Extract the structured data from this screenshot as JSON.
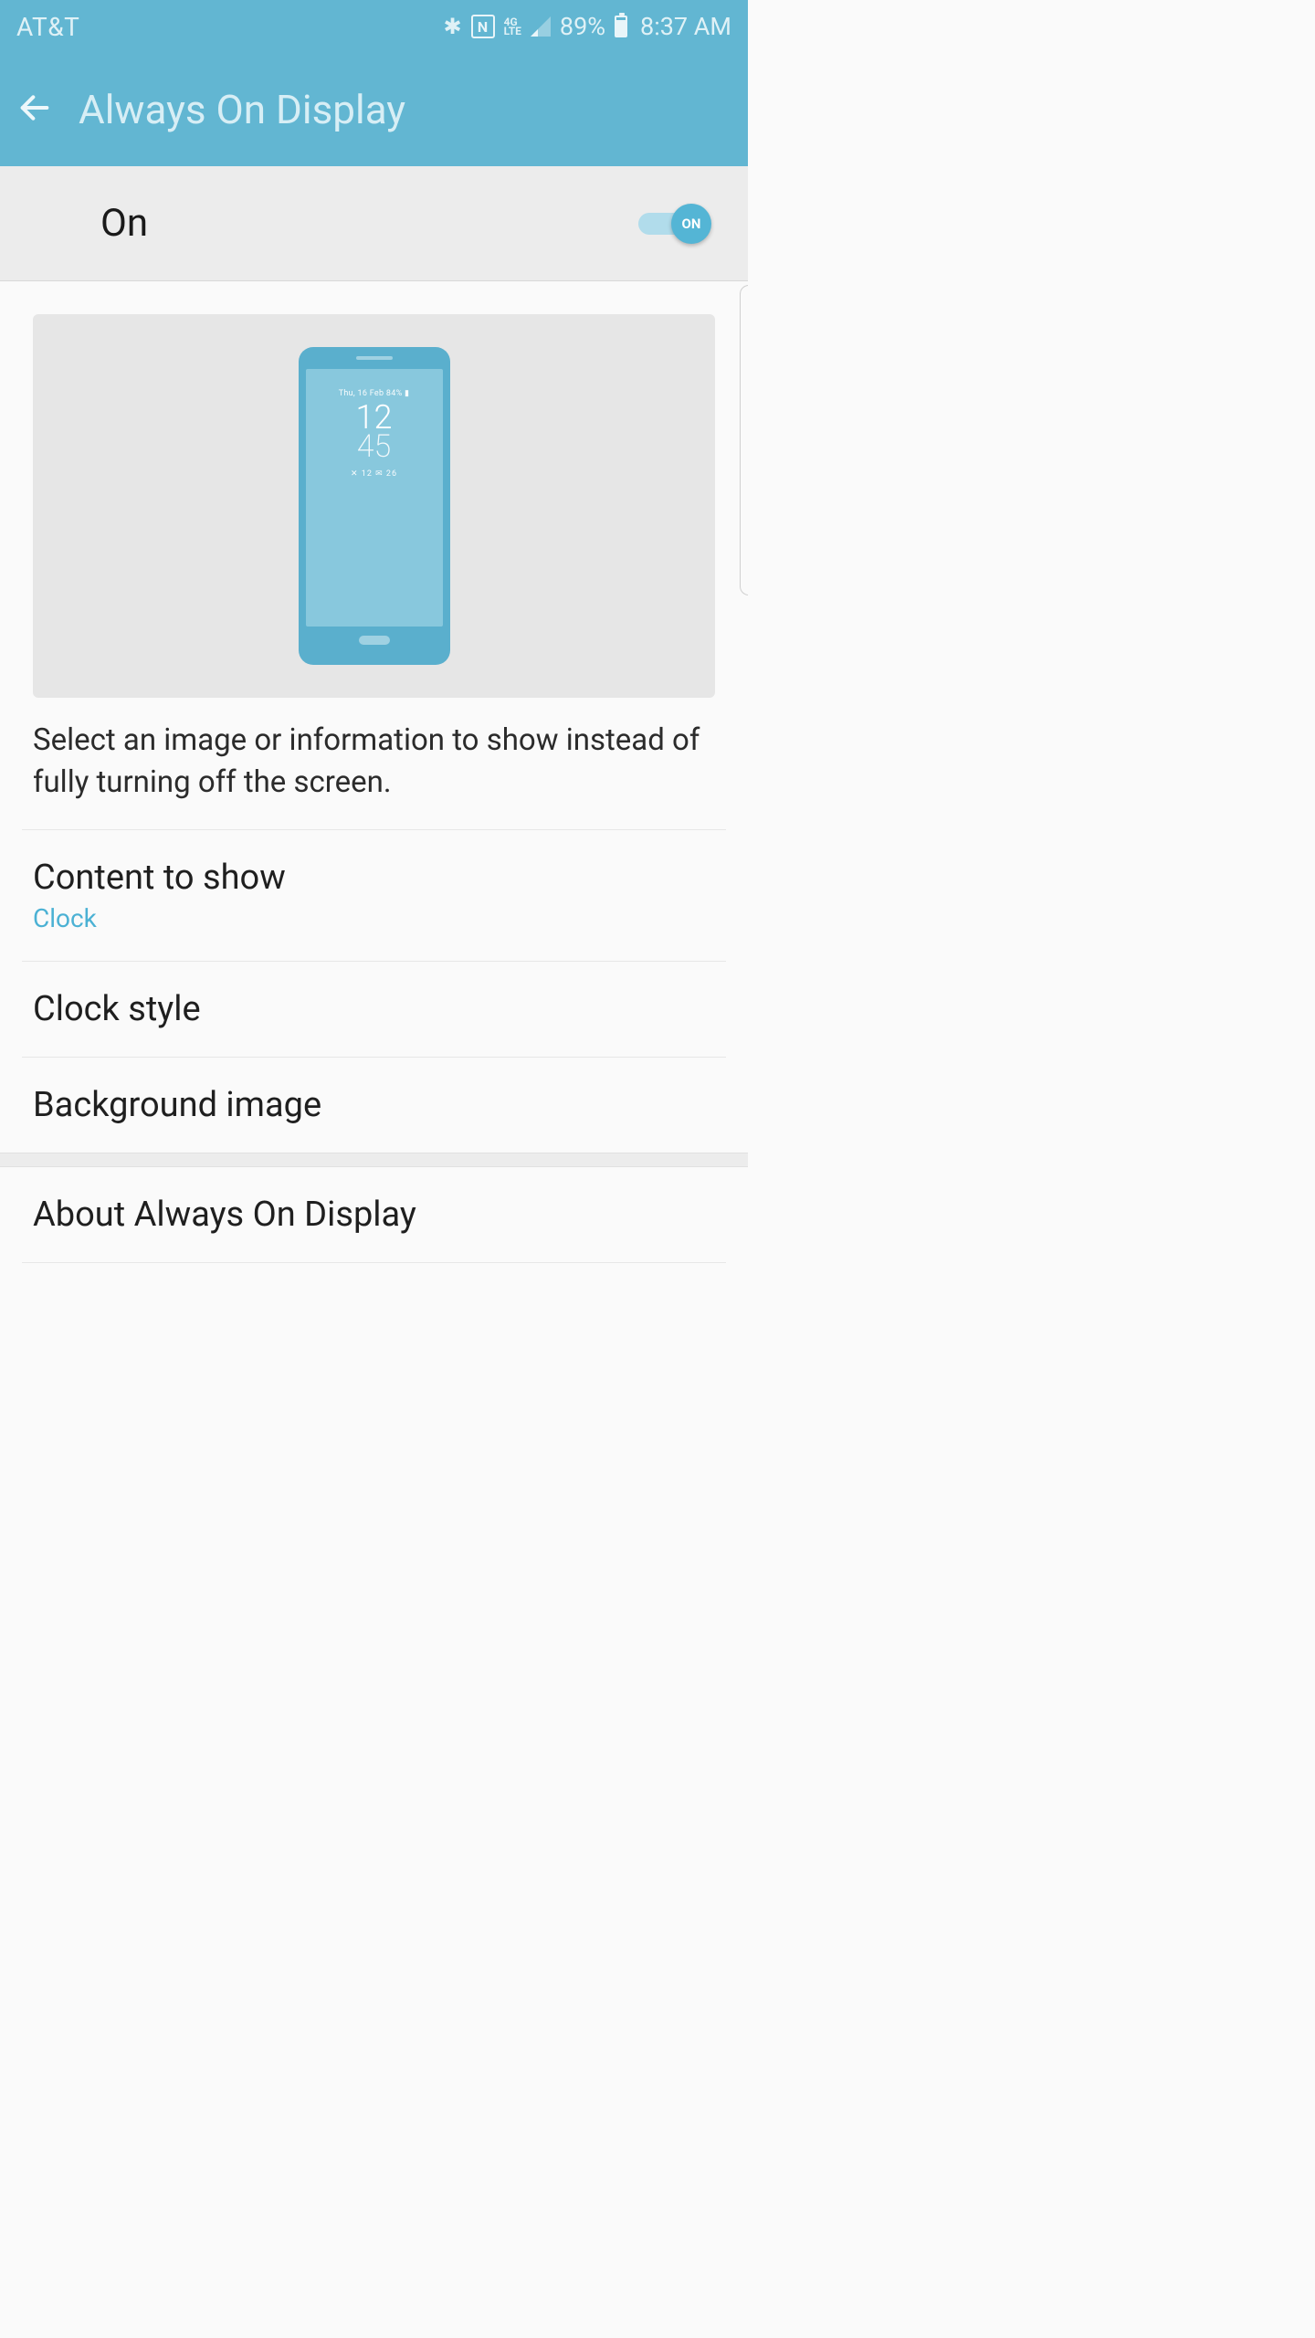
{
  "status": {
    "carrier": "AT&T",
    "battery_pct": "89%",
    "time": "8:37 AM",
    "network": "4G LTE"
  },
  "header": {
    "title": "Always On Display"
  },
  "master": {
    "label": "On",
    "thumb_text": "ON"
  },
  "preview": {
    "date_line": "Thu, 16 Feb  84% ▮",
    "hour": "12",
    "minute": "45",
    "notif_line": "✕ 12    ✉ 26"
  },
  "description": "Select an image or information to show instead of fully turning off the screen.",
  "items": {
    "content_to_show": {
      "title": "Content to show",
      "sub": "Clock"
    },
    "clock_style": {
      "title": "Clock style"
    },
    "background": {
      "title": "Background image"
    },
    "about": {
      "title": "About Always On Display"
    }
  }
}
